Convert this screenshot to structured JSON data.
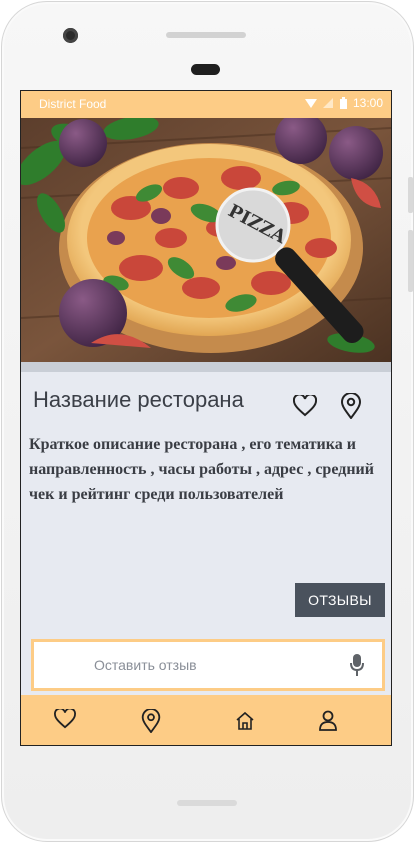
{
  "status_bar": {
    "app_name": "District  Food",
    "time": "13:00",
    "icons": [
      "wifi-icon",
      "signal-icon",
      "battery-icon"
    ]
  },
  "hero": {
    "image": "pizza-photo",
    "pizza_cutter_text": "PIZZA"
  },
  "restaurant": {
    "name": "Название ресторана",
    "description": "Краткое описание ресторана , его тематика и направленность , часы работы , адрес , средний чек и рейтинг среди пользователей"
  },
  "actions": {
    "favorite_icon": "heart-icon",
    "location_icon": "map-pin-icon",
    "reviews_button": "ОТЗЫВЫ"
  },
  "review_input": {
    "placeholder": "Оставить отзыв",
    "value": "",
    "mic_icon": "microphone-icon"
  },
  "bottom_nav": {
    "items": [
      {
        "icon": "heart-icon"
      },
      {
        "icon": "map-pin-icon"
      },
      {
        "icon": "home-icon"
      },
      {
        "icon": "profile-icon"
      }
    ]
  },
  "colors": {
    "accent": "#fdcc86",
    "screen_bg": "#e7eaf1",
    "button_bg": "#4a525d",
    "text_dark": "#3b3f47"
  }
}
